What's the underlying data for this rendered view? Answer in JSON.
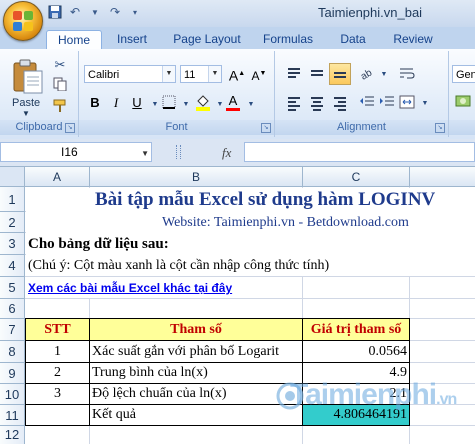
{
  "window": {
    "title": "Taimienphi.vn_bai"
  },
  "tabs": [
    "Home",
    "Insert",
    "Page Layout",
    "Formulas",
    "Data",
    "Review"
  ],
  "ribbon": {
    "clipboard": {
      "paste_label": "Paste",
      "group_label": "Clipboard"
    },
    "font": {
      "font_name": "Calibri",
      "font_size": "11",
      "grow": "A",
      "shrink": "A",
      "bold": "B",
      "italic": "I",
      "underline": "U",
      "fill_letter": "A",
      "color_letter": "A",
      "group_label": "Font"
    },
    "alignment": {
      "group_label": "Alignment"
    },
    "number": {
      "partial_label": "Gen"
    }
  },
  "formula_bar": {
    "name_box": "I16",
    "fx": "fx",
    "formula": ""
  },
  "columns": [
    "A",
    "B",
    "C"
  ],
  "rows": [
    "1",
    "2",
    "3",
    "4",
    "5",
    "6",
    "7",
    "8",
    "9",
    "10",
    "11",
    "12"
  ],
  "sheet": {
    "title": "Bài tập mẫu Excel sử dụng hàm LOGINV",
    "website": "Website: Taimienphi.vn - Betdownload.com",
    "prompt": "Cho bảng dữ liệu sau:",
    "note": "(Chú ý: Cột màu xanh là cột cần nhập công thức tính)",
    "link": "Xem các bài mẫu Excel khác tại đây",
    "headers": {
      "stt": "STT",
      "param": "Tham số",
      "value": "Giá trị tham số"
    },
    "data_rows": [
      {
        "stt": "1",
        "param": "Xác suất gắn với phân bố Logarit",
        "value": "0.0564"
      },
      {
        "stt": "2",
        "param": "Trung bình của ln(x)",
        "value": "4.9"
      },
      {
        "stt": "3",
        "param": "Độ lệch chuẩn của ln(x)",
        "value": "2.1"
      }
    ],
    "result": {
      "label": "Kết quả",
      "value": "4.806464191"
    }
  },
  "watermark": {
    "text": "Taimienphi",
    "suffix": ".vn"
  },
  "colors": {
    "title_blue": "#1f3b8c",
    "header_red": "#c00000",
    "input_fill": "#ffff99",
    "result_fill": "#33cccc",
    "link_blue": "#0000ee"
  }
}
